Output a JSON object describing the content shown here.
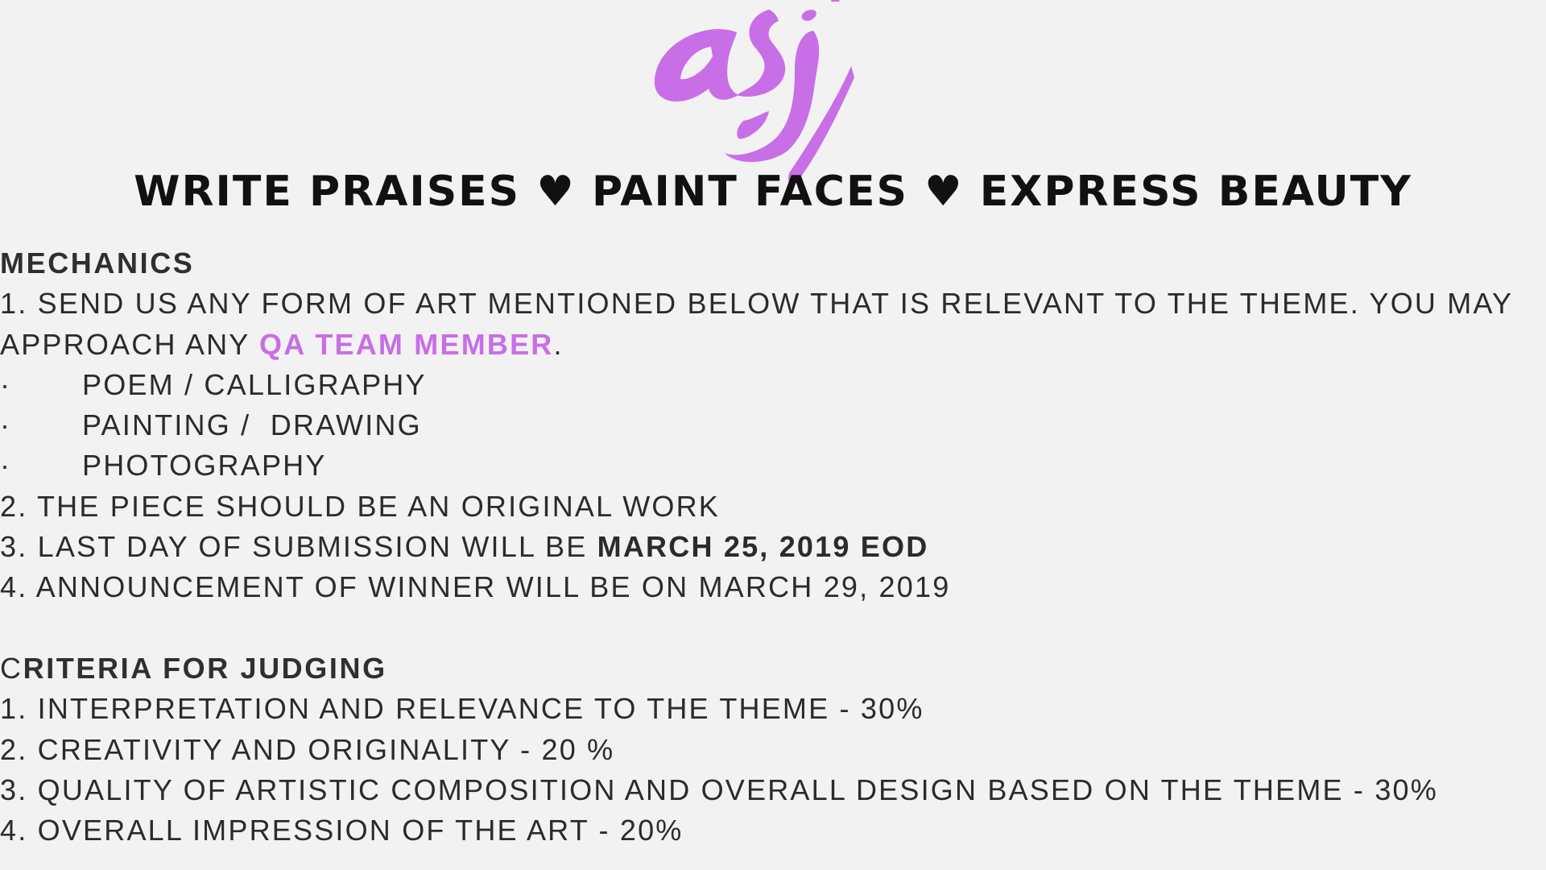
{
  "brand": {
    "logo_text": "asj",
    "accent_color": "#c86ee6"
  },
  "theme": {
    "part1": "WRITE PRAISES",
    "heart1": "♥",
    "part2": "PAINT FACES",
    "heart2": "♥",
    "part3": "EXPRESS BEAUTY"
  },
  "mechanics": {
    "heading": "MECHANICS",
    "item1_text": "1. SEND US ANY FORM OF ART MENTIONED BELOW THAT IS RELEVANT TO THE THEME. YOU MAY",
    "item1_cont_pre": "APPROACH ANY ",
    "item1_cont_highlight": "QA TEAM MEMBER",
    "item1_cont_post": ".",
    "bullet_char": "·",
    "bullets": [
      "POEM / CALLIGRAPHY",
      "PAINTING /  DRAWING",
      "PHOTOGRAPHY"
    ],
    "item2": "2. THE PIECE SHOULD BE AN ORIGINAL WORK",
    "item3_pre": "3. LAST DAY OF SUBMISSION WILL BE ",
    "item3_bold": "MARCH 25, 2019 EOD",
    "item4": "4. ANNOUNCEMENT OF WINNER WILL BE ON MARCH 29, 2019"
  },
  "criteria": {
    "heading_first": "C",
    "heading_rest": "RITERIA FOR JUDGING",
    "items": [
      "1. INTERPRETATION AND RELEVANCE TO THE THEME - 30%",
      "2. CREATIVITY AND ORIGINALITY - 20 %",
      "3. QUALITY OF ARTISTIC COMPOSITION AND OVERALL DESIGN BASED ON THE THEME - 30%",
      "4. OVERALL IMPRESSION OF THE ART - 20%"
    ]
  }
}
